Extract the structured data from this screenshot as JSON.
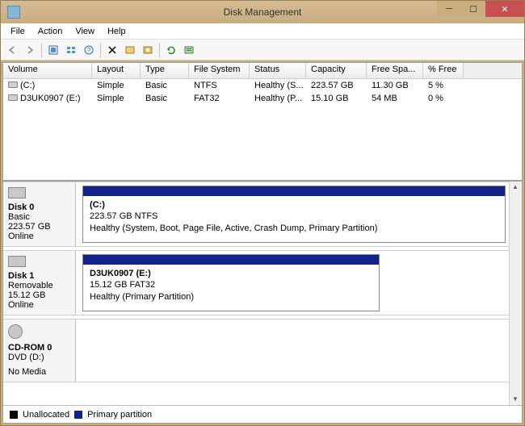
{
  "window": {
    "title": "Disk Management"
  },
  "menus": {
    "file": "File",
    "action": "Action",
    "view": "View",
    "help": "Help"
  },
  "volumes": {
    "headers": [
      "Volume",
      "Layout",
      "Type",
      "File System",
      "Status",
      "Capacity",
      "Free Spa...",
      "% Free"
    ],
    "rows": [
      {
        "name": "(C:)",
        "layout": "Simple",
        "type": "Basic",
        "fs": "NTFS",
        "status": "Healthy (S...",
        "capacity": "223.57 GB",
        "free": "11.30 GB",
        "pct": "5 %"
      },
      {
        "name": "D3UK0907 (E:)",
        "layout": "Simple",
        "type": "Basic",
        "fs": "FAT32",
        "status": "Healthy (P...",
        "capacity": "15.10 GB",
        "free": "54 MB",
        "pct": "0 %"
      }
    ]
  },
  "disks": [
    {
      "name": "Disk 0",
      "kind": "Basic",
      "size": "223.57 GB",
      "state": "Online",
      "partitions": [
        {
          "title": "(C:)",
          "detail": "223.57 GB NTFS",
          "status": "Healthy (System, Boot, Page File, Active, Crash Dump, Primary Partition)"
        }
      ]
    },
    {
      "name": "Disk 1",
      "kind": "Removable",
      "size": "15.12 GB",
      "state": "Online",
      "partitions": [
        {
          "title": "D3UK0907  (E:)",
          "detail": "15.12 GB FAT32",
          "status": "Healthy (Primary Partition)"
        }
      ]
    },
    {
      "name": "CD-ROM 0",
      "kind": "DVD (D:)",
      "size": "",
      "state": "No Media",
      "partitions": []
    }
  ],
  "legend": {
    "unallocated": "Unallocated",
    "primary": "Primary partition"
  }
}
